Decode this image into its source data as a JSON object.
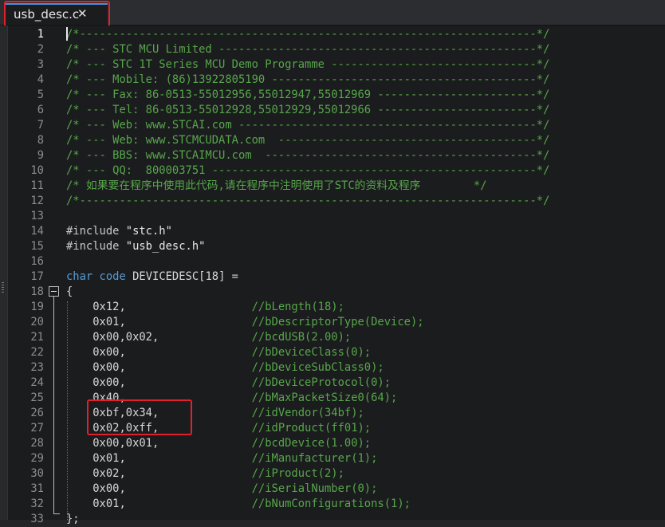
{
  "tab": {
    "filename": "usb_desc.c",
    "close_glyph": "✕"
  },
  "editor": {
    "current_line": 1,
    "lines": [
      {
        "n": "1",
        "tokens": [
          {
            "t": "/*---------------------------------------------------------------------*/",
            "c": "cmt"
          }
        ]
      },
      {
        "n": "2",
        "tokens": [
          {
            "t": "/* --- STC MCU Limited ------------------------------------------------*/",
            "c": "cmt"
          }
        ]
      },
      {
        "n": "3",
        "tokens": [
          {
            "t": "/* --- STC 1T Series MCU Demo Programme -------------------------------*/",
            "c": "cmt"
          }
        ]
      },
      {
        "n": "4",
        "tokens": [
          {
            "t": "/* --- Mobile: (86)13922805190 ----------------------------------------*/",
            "c": "cmt"
          }
        ]
      },
      {
        "n": "5",
        "tokens": [
          {
            "t": "/* --- Fax: 86-0513-55012956,55012947,55012969 ------------------------*/",
            "c": "cmt"
          }
        ]
      },
      {
        "n": "6",
        "tokens": [
          {
            "t": "/* --- Tel: 86-0513-55012928,55012929,55012966 ------------------------*/",
            "c": "cmt"
          }
        ]
      },
      {
        "n": "7",
        "tokens": [
          {
            "t": "/* --- Web: www.STCAI.com ---------------------------------------------*/",
            "c": "cmt"
          }
        ]
      },
      {
        "n": "8",
        "tokens": [
          {
            "t": "/* --- Web: www.STCMCUDATA.com  ---------------------------------------*/",
            "c": "cmt"
          }
        ]
      },
      {
        "n": "9",
        "tokens": [
          {
            "t": "/* --- BBS: www.STCAIMCU.com  -----------------------------------------*/",
            "c": "cmt"
          }
        ]
      },
      {
        "n": "10",
        "tokens": [
          {
            "t": "/* --- QQ:  800003751 -------------------------------------------------*/",
            "c": "cmt"
          }
        ]
      },
      {
        "n": "11",
        "tokens": [
          {
            "t": "/* 如果要在程序中使用此代码,请在程序中注明使用了STC的资料及程序        */",
            "c": "cmt"
          }
        ]
      },
      {
        "n": "12",
        "tokens": [
          {
            "t": "/*---------------------------------------------------------------------*/",
            "c": "cmt"
          }
        ]
      },
      {
        "n": "13",
        "tokens": []
      },
      {
        "n": "14",
        "tokens": [
          {
            "t": "#include ",
            "c": "pp"
          },
          {
            "t": "\"stc.h\"",
            "c": "str"
          }
        ]
      },
      {
        "n": "15",
        "tokens": [
          {
            "t": "#include ",
            "c": "pp"
          },
          {
            "t": "\"usb_desc.h\"",
            "c": "str"
          }
        ]
      },
      {
        "n": "16",
        "tokens": []
      },
      {
        "n": "17",
        "tokens": [
          {
            "t": "char",
            "c": "kw"
          },
          {
            "t": " "
          },
          {
            "t": "code",
            "c": "kw"
          },
          {
            "t": " DEVICEDESC[18] ="
          }
        ]
      },
      {
        "n": "18",
        "tokens": [
          {
            "t": "{"
          }
        ]
      },
      {
        "n": "19",
        "tokens": [
          {
            "t": "    0x12,                   "
          },
          {
            "t": "//bLength(18);",
            "c": "cmt"
          }
        ]
      },
      {
        "n": "20",
        "tokens": [
          {
            "t": "    0x01,                   "
          },
          {
            "t": "//bDescriptorType(Device);",
            "c": "cmt"
          }
        ]
      },
      {
        "n": "21",
        "tokens": [
          {
            "t": "    0x00,0x02,              "
          },
          {
            "t": "//bcdUSB(2.00);",
            "c": "cmt"
          }
        ]
      },
      {
        "n": "22",
        "tokens": [
          {
            "t": "    0x00,                   "
          },
          {
            "t": "//bDeviceClass(0);",
            "c": "cmt"
          }
        ]
      },
      {
        "n": "23",
        "tokens": [
          {
            "t": "    0x00,                   "
          },
          {
            "t": "//bDeviceSubClass0);",
            "c": "cmt"
          }
        ]
      },
      {
        "n": "24",
        "tokens": [
          {
            "t": "    0x00,                   "
          },
          {
            "t": "//bDeviceProtocol(0);",
            "c": "cmt"
          }
        ]
      },
      {
        "n": "25",
        "tokens": [
          {
            "t": "    0x40,                   "
          },
          {
            "t": "//bMaxPacketSize0(64);",
            "c": "cmt"
          }
        ]
      },
      {
        "n": "26",
        "tokens": [
          {
            "t": "    0xbf,0x34,              "
          },
          {
            "t": "//idVendor(34bf);",
            "c": "cmt"
          }
        ]
      },
      {
        "n": "27",
        "tokens": [
          {
            "t": "    0x02,0xff,              "
          },
          {
            "t": "//idProduct(ff01);",
            "c": "cmt"
          }
        ]
      },
      {
        "n": "28",
        "tokens": [
          {
            "t": "    0x00,0x01,              "
          },
          {
            "t": "//bcdDevice(1.00);",
            "c": "cmt"
          }
        ]
      },
      {
        "n": "29",
        "tokens": [
          {
            "t": "    0x01,                   "
          },
          {
            "t": "//iManufacturer(1);",
            "c": "cmt"
          }
        ]
      },
      {
        "n": "30",
        "tokens": [
          {
            "t": "    0x02,                   "
          },
          {
            "t": "//iProduct(2);",
            "c": "cmt"
          }
        ]
      },
      {
        "n": "31",
        "tokens": [
          {
            "t": "    0x00,                   "
          },
          {
            "t": "//iSerialNumber(0);",
            "c": "cmt"
          }
        ]
      },
      {
        "n": "32",
        "tokens": [
          {
            "t": "    0x01,                   "
          },
          {
            "t": "//bNumConfigurations(1);",
            "c": "cmt"
          }
        ]
      },
      {
        "n": "33",
        "tokens": [
          {
            "t": "};"
          }
        ]
      }
    ]
  },
  "colors": {
    "background": "#1b1c1e",
    "comment": "#57a64a",
    "keyword": "#569cd6",
    "highlight_box": "#e0202a"
  }
}
